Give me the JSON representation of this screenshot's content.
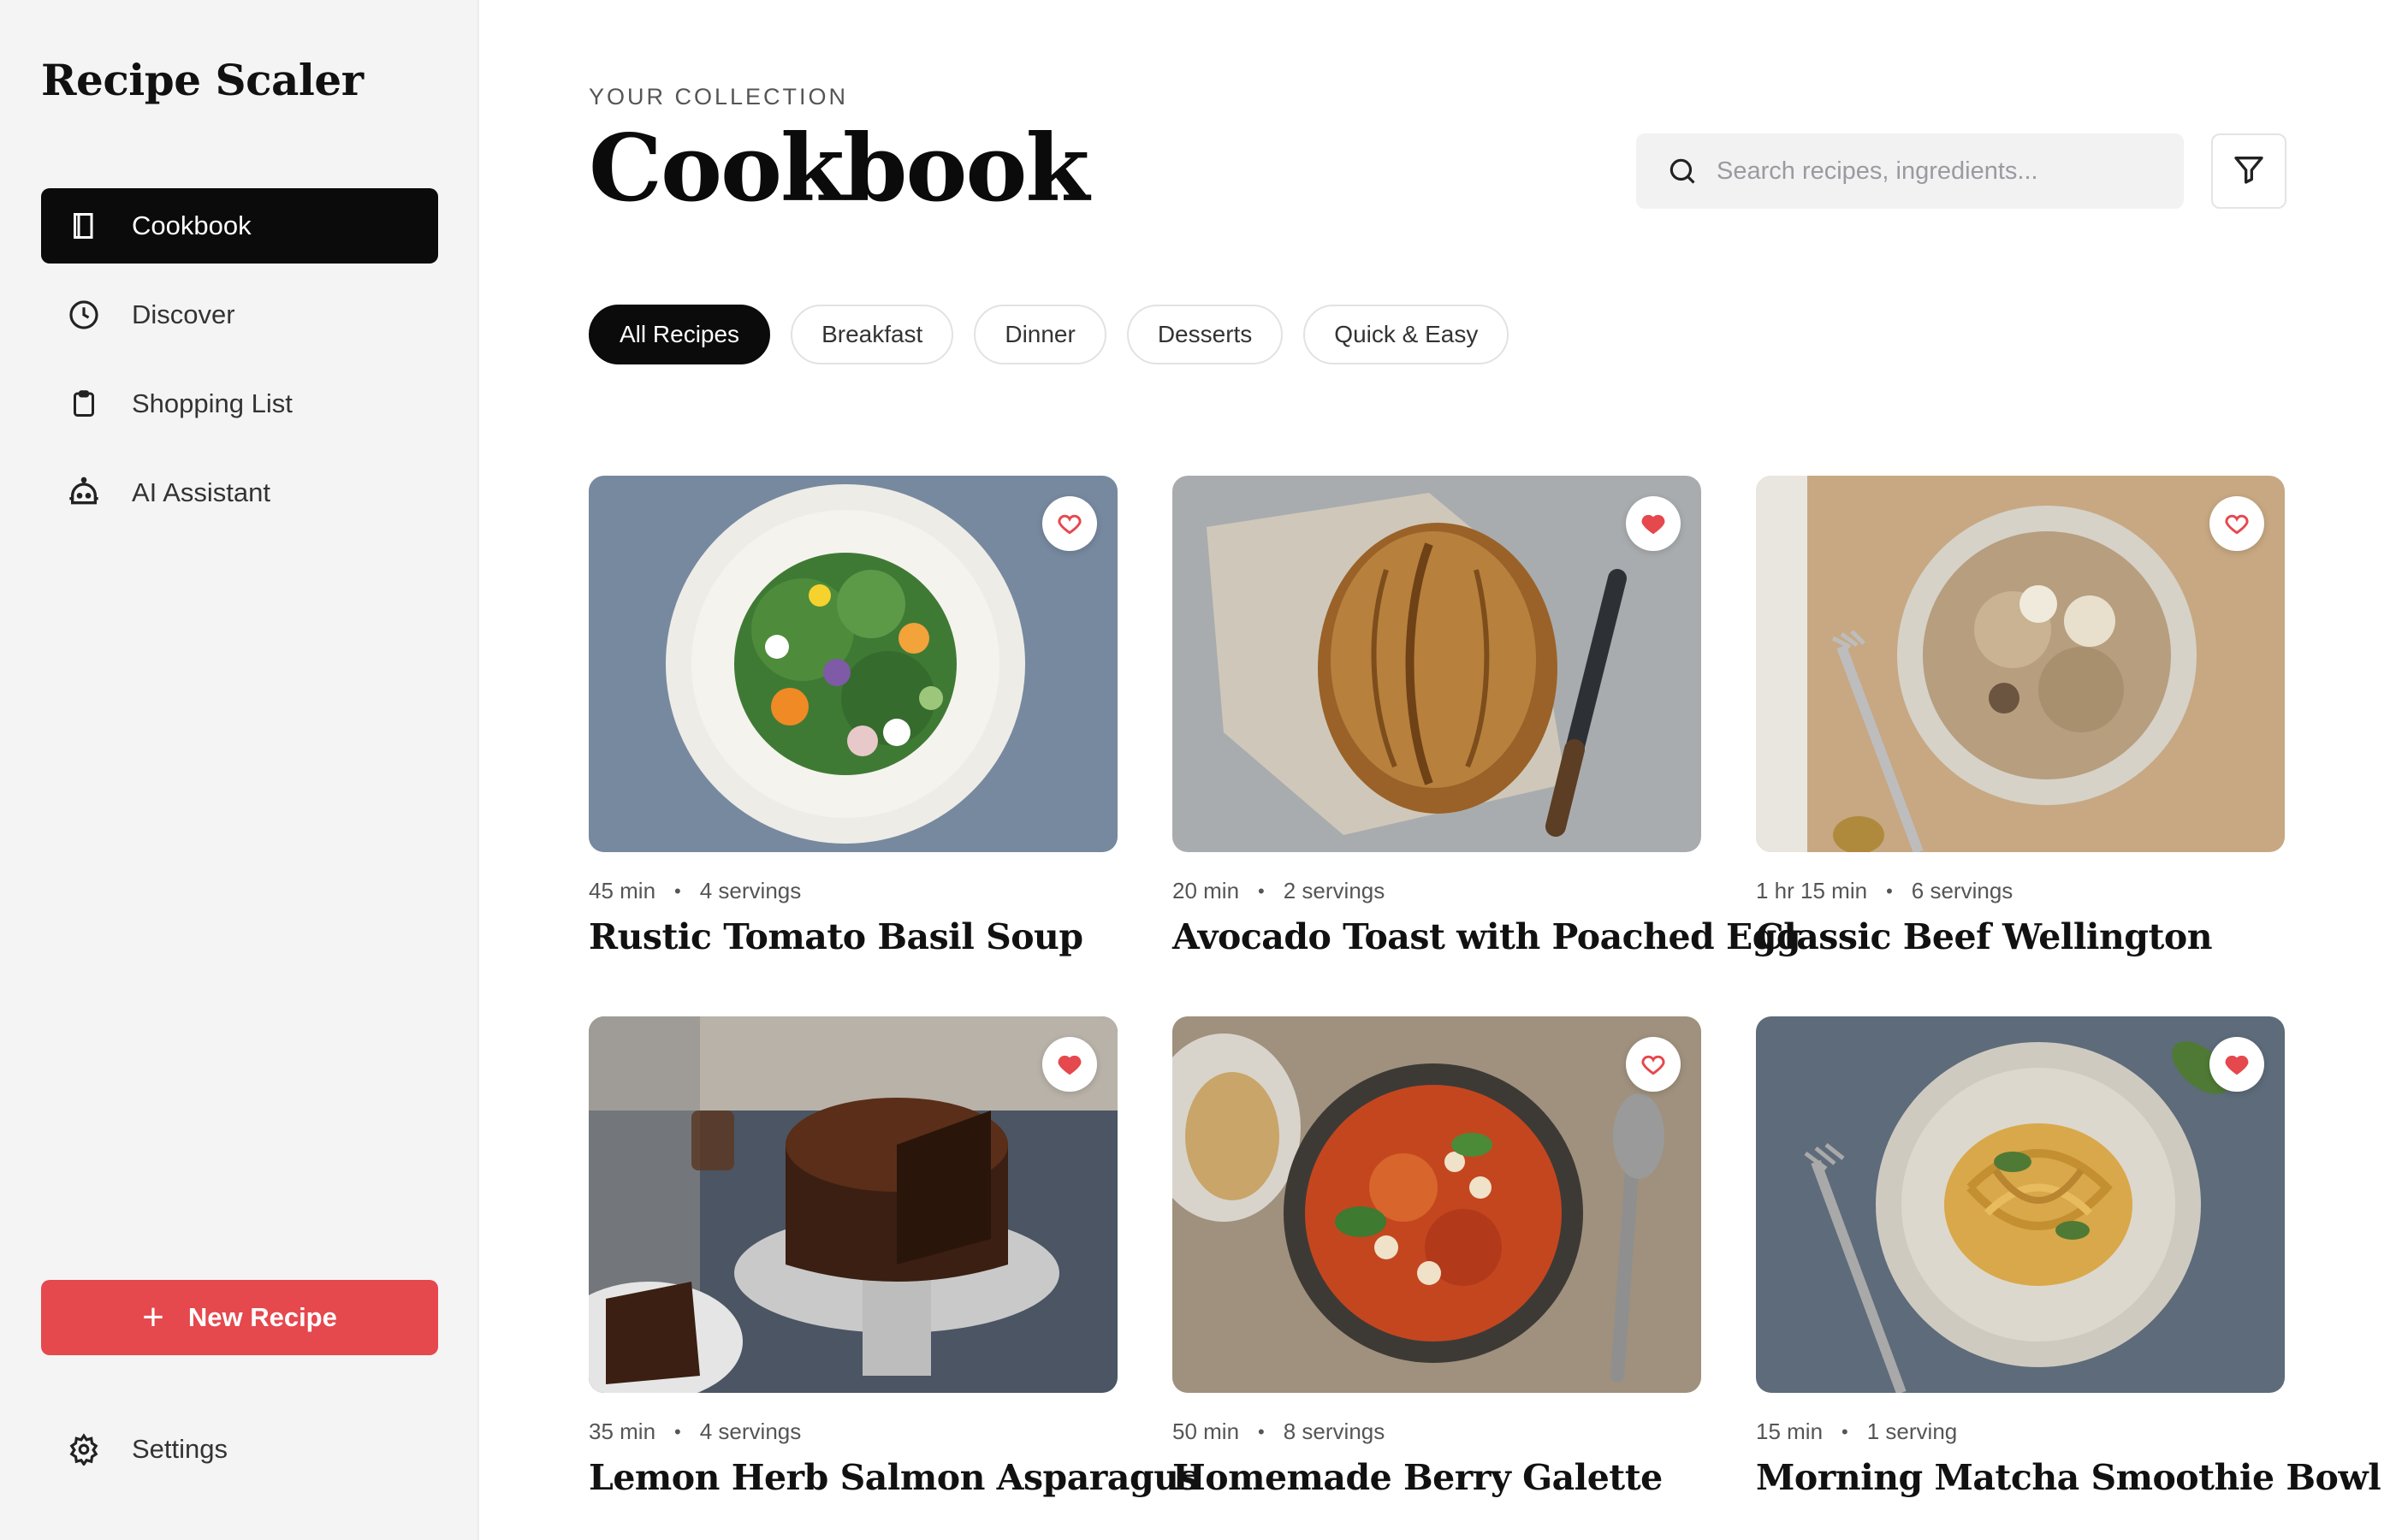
{
  "app": {
    "title": "Recipe Scaler"
  },
  "sidebar": {
    "items": [
      {
        "label": "Cookbook",
        "icon": "book-icon",
        "active": true
      },
      {
        "label": "Discover",
        "icon": "clock-icon",
        "active": false
      },
      {
        "label": "Shopping List",
        "icon": "clipboard-icon",
        "active": false
      },
      {
        "label": "AI Assistant",
        "icon": "robot-icon",
        "active": false
      }
    ],
    "new_recipe_label": "New Recipe",
    "settings_label": "Settings"
  },
  "header": {
    "eyebrow": "YOUR COLLECTION",
    "title": "Cookbook",
    "search_placeholder": "Search recipes, ingredients..."
  },
  "filters": [
    "All Recipes",
    "Breakfast",
    "Dinner",
    "Desserts",
    "Quick & Easy"
  ],
  "active_filter": "All Recipes",
  "colors": {
    "accent": "#e5484d",
    "dark": "#0b0b0b"
  },
  "recipes": [
    {
      "time": "45 min",
      "servings": "4 servings",
      "title": "Rustic Tomato Basil Soup",
      "favorite": false
    },
    {
      "time": "20 min",
      "servings": "2 servings",
      "title": "Avocado Toast with Poached Egg",
      "favorite": true
    },
    {
      "time": "1 hr 15 min",
      "servings": "6 servings",
      "title": "Classic Beef Wellington",
      "favorite": false
    },
    {
      "time": "35 min",
      "servings": "4 servings",
      "title": "Lemon Herb Salmon Asparagus",
      "favorite": true
    },
    {
      "time": "50 min",
      "servings": "8 servings",
      "title": "Homemade Berry Galette",
      "favorite": false
    },
    {
      "time": "15 min",
      "servings": "1 serving",
      "title": "Morning Matcha Smoothie Bowl",
      "favorite": true
    }
  ]
}
